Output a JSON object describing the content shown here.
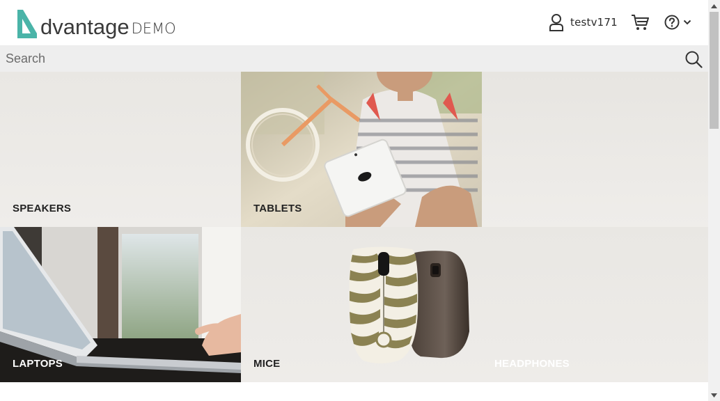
{
  "header": {
    "logo_main": "dvantage",
    "logo_sub": "DEMO",
    "username": "testv171",
    "icons": {
      "user": "user-icon",
      "cart": "cart-icon",
      "help": "help-icon",
      "chevron": "chevron-down-icon"
    }
  },
  "search": {
    "placeholder": "Search",
    "icon": "search-icon"
  },
  "categories": {
    "speakers": "SPEAKERS",
    "tablets": "TABLETS",
    "laptops": "LAPTOPS",
    "mice": "MICE",
    "headphones": "HEADPHONES"
  },
  "colors": {
    "brand_teal": "#4ab4a8",
    "text_dark": "#222222",
    "search_bg": "#eeeeee"
  }
}
